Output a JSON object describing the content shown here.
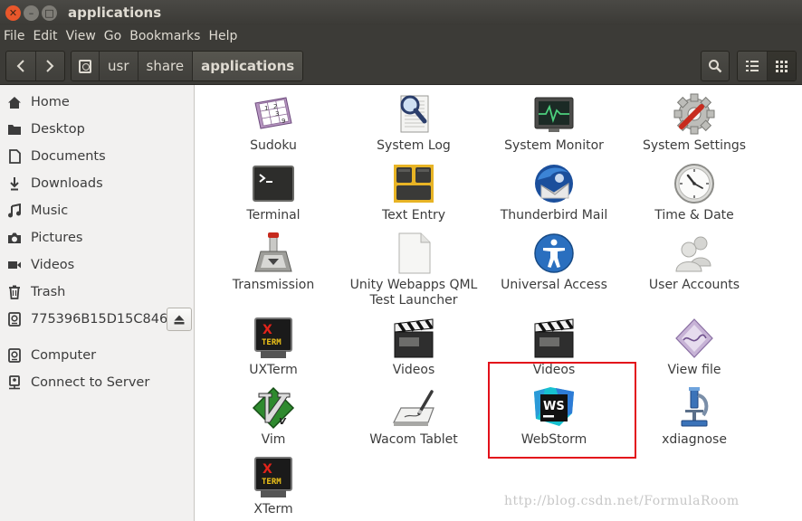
{
  "window": {
    "title": "applications"
  },
  "menubar": [
    "File",
    "Edit",
    "View",
    "Go",
    "Bookmarks",
    "Help"
  ],
  "pathbar": {
    "segments": [
      "usr",
      "share",
      "applications"
    ],
    "active": "applications"
  },
  "sidebar": {
    "items": [
      {
        "label": "Home",
        "icon": "home-icon"
      },
      {
        "label": "Desktop",
        "icon": "folder-icon"
      },
      {
        "label": "Documents",
        "icon": "document-icon"
      },
      {
        "label": "Downloads",
        "icon": "download-icon"
      },
      {
        "label": "Music",
        "icon": "music-icon"
      },
      {
        "label": "Pictures",
        "icon": "camera-icon"
      },
      {
        "label": "Videos",
        "icon": "video-icon"
      },
      {
        "label": "Trash",
        "icon": "trash-icon"
      },
      {
        "label": "775396B15D15C846",
        "icon": "drive-icon"
      }
    ],
    "network": [
      {
        "label": "Computer",
        "icon": "computer-icon"
      },
      {
        "label": "Connect to Server",
        "icon": "server-icon"
      }
    ]
  },
  "files": [
    {
      "label": "Sudoku",
      "icon": "sudoku-icon"
    },
    {
      "label": "System Log",
      "icon": "system-log-icon"
    },
    {
      "label": "System Monitor",
      "icon": "system-monitor-icon"
    },
    {
      "label": "System Settings",
      "icon": "system-settings-icon"
    },
    {
      "label": "Terminal",
      "icon": "terminal-icon"
    },
    {
      "label": "Text Entry",
      "icon": "text-entry-icon"
    },
    {
      "label": "Thunderbird Mail",
      "icon": "thunderbird-icon"
    },
    {
      "label": "Time & Date",
      "icon": "clock-icon"
    },
    {
      "label": "Transmission",
      "icon": "transmission-icon"
    },
    {
      "label": "Unity Webapps QML Test Launcher",
      "icon": "blank-file-icon"
    },
    {
      "label": "Universal Access",
      "icon": "universal-access-icon"
    },
    {
      "label": "User Accounts",
      "icon": "user-accounts-icon"
    },
    {
      "label": "UXTerm",
      "icon": "xterm-icon"
    },
    {
      "label": "Videos",
      "icon": "clapperboard-icon"
    },
    {
      "label": "Videos",
      "icon": "clapperboard-icon"
    },
    {
      "label": "View file",
      "icon": "view-file-icon"
    },
    {
      "label": "Vim",
      "icon": "vim-icon"
    },
    {
      "label": "Wacom Tablet",
      "icon": "wacom-tablet-icon"
    },
    {
      "label": "WebStorm",
      "icon": "webstorm-icon"
    },
    {
      "label": "xdiagnose",
      "icon": "microscope-icon"
    },
    {
      "label": "XTerm",
      "icon": "xterm-icon"
    }
  ],
  "icon_text": {
    "xterm_top": "X",
    "xterm_bottom": "TERM",
    "webstorm": "WS",
    "vim": "V",
    "sudoku": [
      "1",
      "2",
      "3",
      "9"
    ]
  },
  "watermark": "http://blog.csdn.net/FormulaRoom",
  "colors": {
    "titlebar": "#3c3b37",
    "close_button": "#e9572b",
    "highlight": "#e3101a",
    "sidebar": "#f2f1f0"
  }
}
